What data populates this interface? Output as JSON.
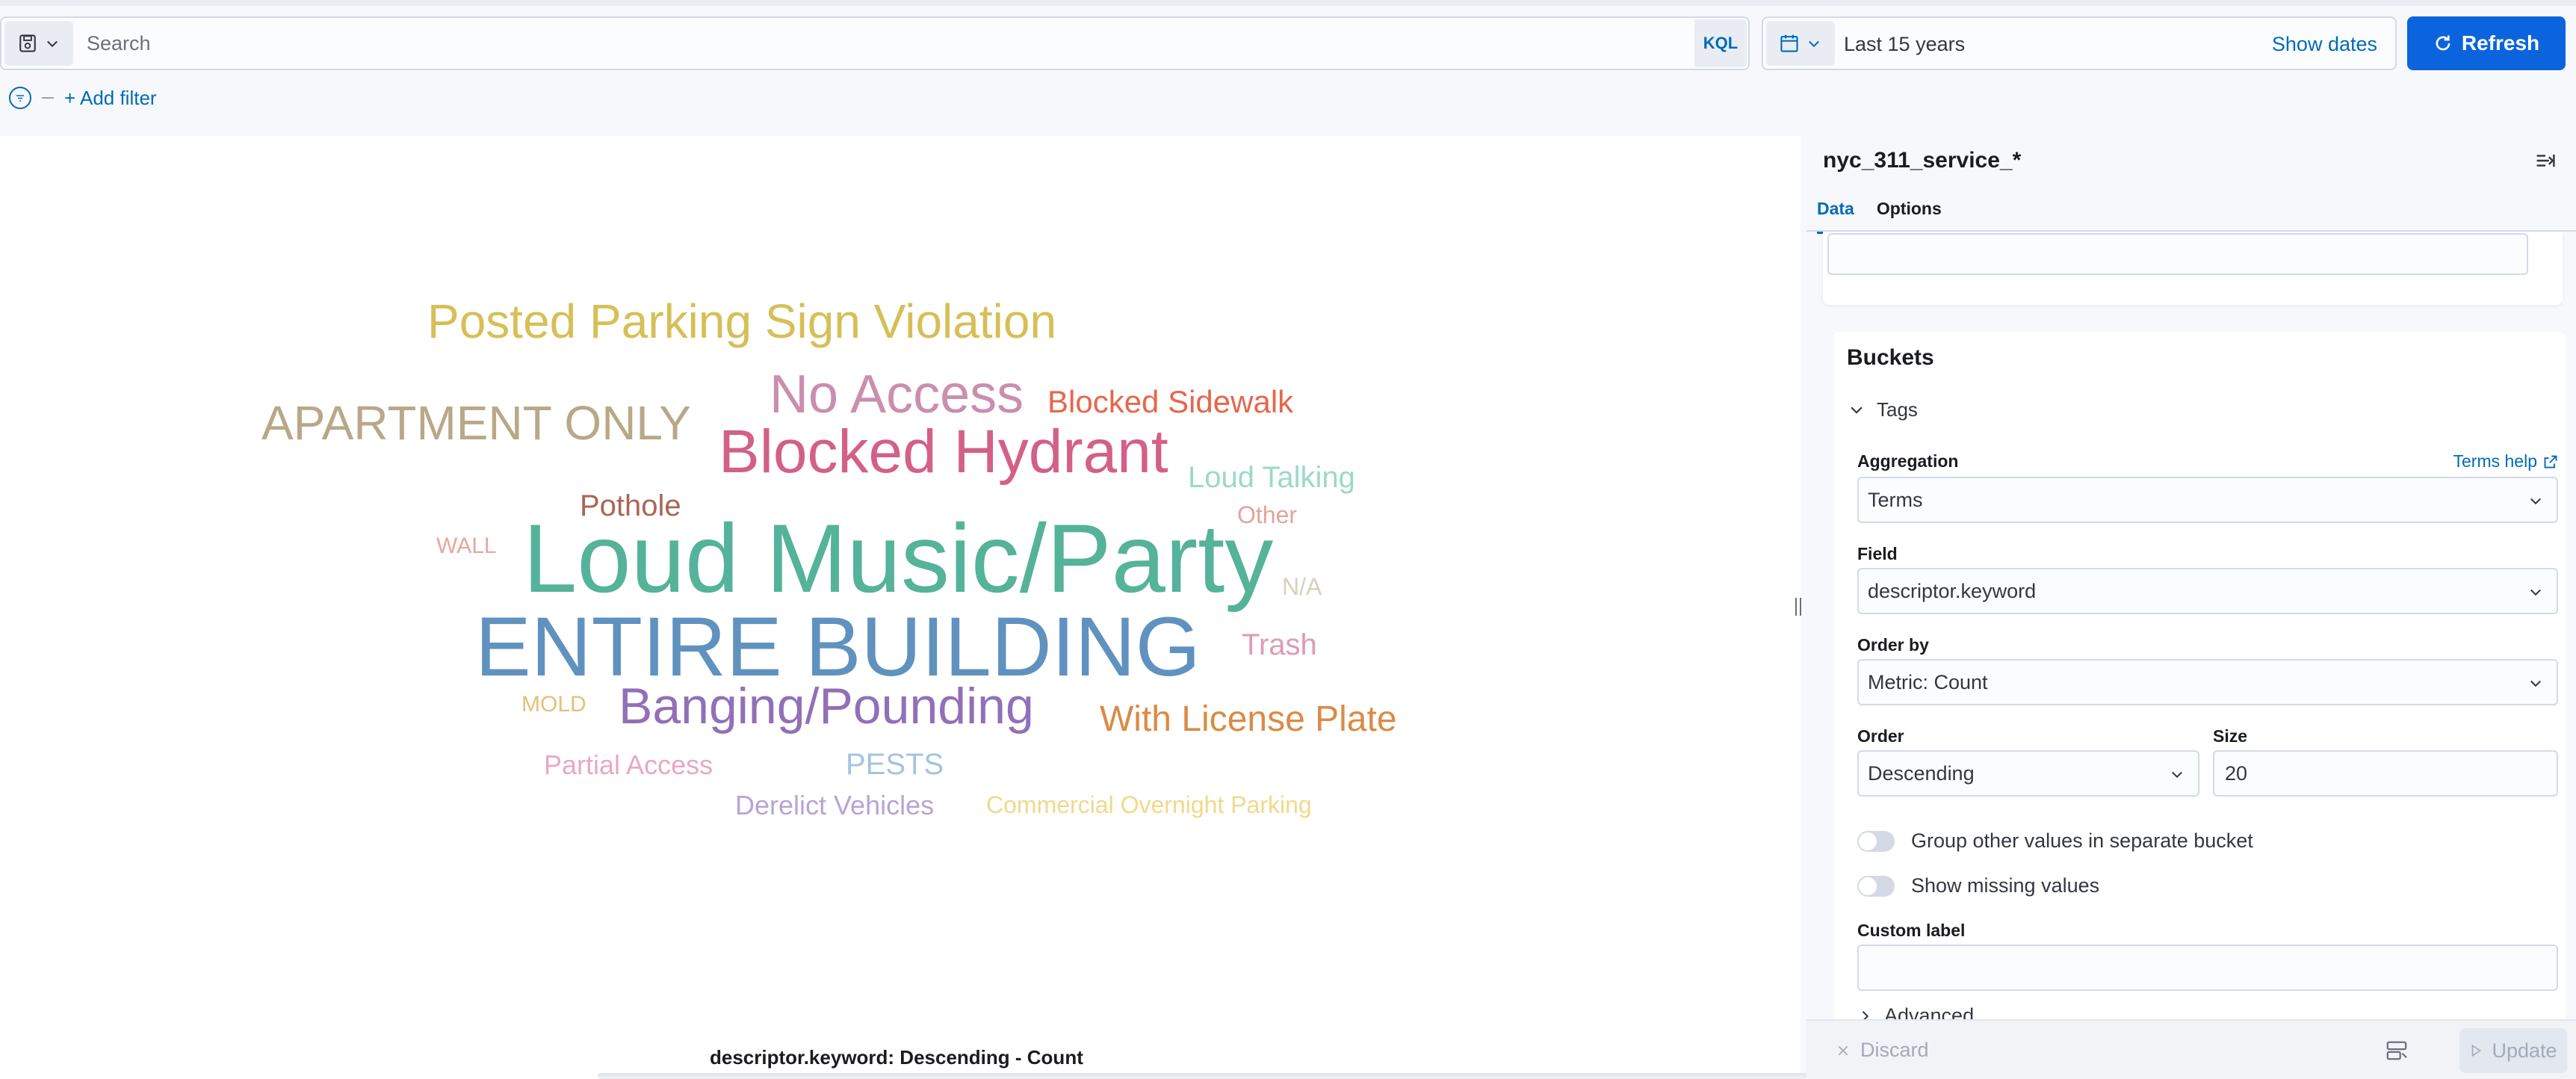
{
  "query_bar": {
    "search_placeholder": "Search",
    "language_label": "KQL"
  },
  "date_picker": {
    "range_label": "Last 15 years",
    "show_dates_label": "Show dates"
  },
  "refresh_label": "Refresh",
  "filter_bar": {
    "add_filter_label": "+ Add filter"
  },
  "visualization": {
    "caption": "descriptor.keyword: Descending - Count",
    "words": [
      {
        "text": "Posted Parking Sign Violation",
        "color": "#d6bf57"
      },
      {
        "text": "No Access",
        "color": "#ca8eae"
      },
      {
        "text": "Blocked Sidewalk",
        "color": "#e7664c"
      },
      {
        "text": "APARTMENT ONLY",
        "color": "#b9a888"
      },
      {
        "text": "Blocked Hydrant",
        "color": "#d36086"
      },
      {
        "text": "Loud Talking",
        "color": "#9cd8c8"
      },
      {
        "text": "Pothole",
        "color": "#aa6556"
      },
      {
        "text": "Other",
        "color": "#e1a59b"
      },
      {
        "text": "WALL",
        "color": "#e4a8a0"
      },
      {
        "text": "Loud Music/Party",
        "color": "#54b399"
      },
      {
        "text": "N/A",
        "color": "#d6d1be"
      },
      {
        "text": "ENTIRE BUILDING",
        "color": "#6092c0"
      },
      {
        "text": "Trash",
        "color": "#dd9bb5"
      },
      {
        "text": "MOLD",
        "color": "#e6c07a"
      },
      {
        "text": "Banging/Pounding",
        "color": "#9170b8"
      },
      {
        "text": "With License Plate",
        "color": "#da8b45"
      },
      {
        "text": "Partial Access",
        "color": "#e8a8c4"
      },
      {
        "text": "PESTS",
        "color": "#a3c4e0"
      },
      {
        "text": "Derelict Vehicles",
        "color": "#b9a3d6"
      },
      {
        "text": "Commercial Overnight Parking",
        "color": "#f0d98a"
      }
    ]
  },
  "panel": {
    "index_pattern": "nyc_311_service_*",
    "tabs": [
      "Data",
      "Options"
    ],
    "buckets_title": "Buckets",
    "bucket_type": "Tags",
    "aggregation_label": "Aggregation",
    "terms_help_label": "Terms help",
    "aggregation_value": "Terms",
    "field_label": "Field",
    "field_value": "descriptor.keyword",
    "order_by_label": "Order by",
    "order_by_value": "Metric: Count",
    "order_label": "Order",
    "order_value": "Descending",
    "size_label": "Size",
    "size_value": "20",
    "group_other_label": "Group other values in separate bucket",
    "show_missing_label": "Show missing values",
    "custom_label_label": "Custom label",
    "advanced_label": "Advanced",
    "discard_label": "Discard",
    "update_label": "Update"
  }
}
